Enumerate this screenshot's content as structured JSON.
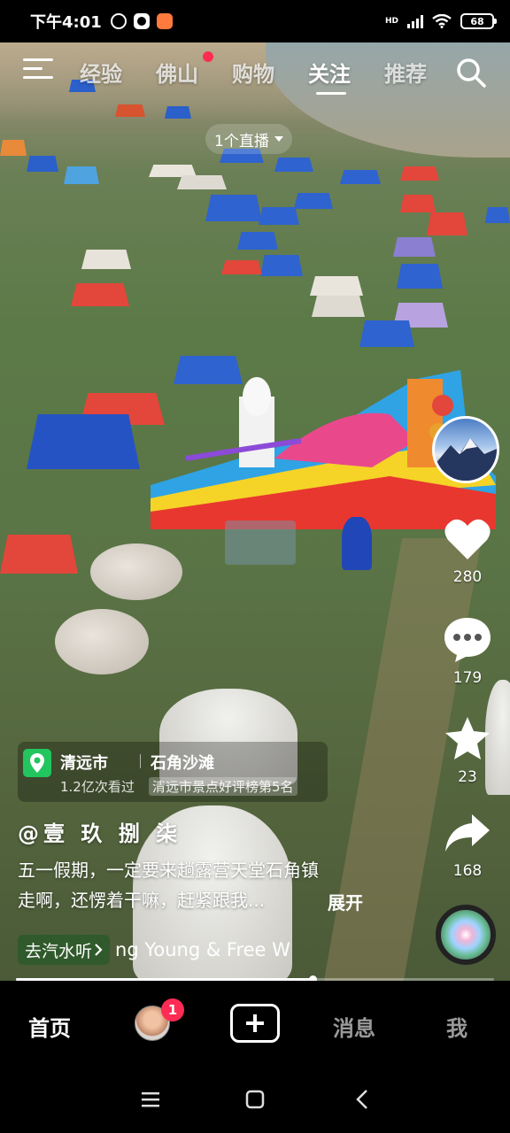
{
  "status_bar": {
    "time": "下午4:01",
    "network": "HD",
    "battery": "68"
  },
  "top_nav": {
    "tabs": [
      "经验",
      "佛山",
      "购物",
      "关注",
      "推荐"
    ],
    "active_tab": "关注",
    "live_label": "1个直播"
  },
  "right_rail": {
    "likes": "280",
    "comments": "179",
    "favorites": "23",
    "shares": "168"
  },
  "video_info": {
    "location_city": "清远市",
    "location_place": "石角沙滩",
    "views": "1.2亿次看过",
    "rank": "清远市景点好评榜第5名",
    "author": "@壹 玖 捌 柒",
    "caption_line1": "五一假期，一定要来趟露营天堂石角镇",
    "caption_line2": "走啊，还愣着干嘛，赶紧跟我...",
    "expand_label": "展开",
    "music_button": "去汽水听",
    "music_title": "ng Young & Free   W",
    "progress": 0.62
  },
  "bottom_nav": {
    "home": "首页",
    "badge": "1",
    "messages": "消息",
    "me": "我"
  },
  "colors": {
    "accent": "#fe2c55",
    "location_green": "#22c55e"
  },
  "icons": [
    "menu-icon",
    "search-icon",
    "heart-icon",
    "comment-icon",
    "star-icon",
    "share-icon",
    "location-pin-icon",
    "chevron-right-icon",
    "plus-icon",
    "menu-lines-icon",
    "home-square-icon",
    "back-arrow-icon"
  ]
}
